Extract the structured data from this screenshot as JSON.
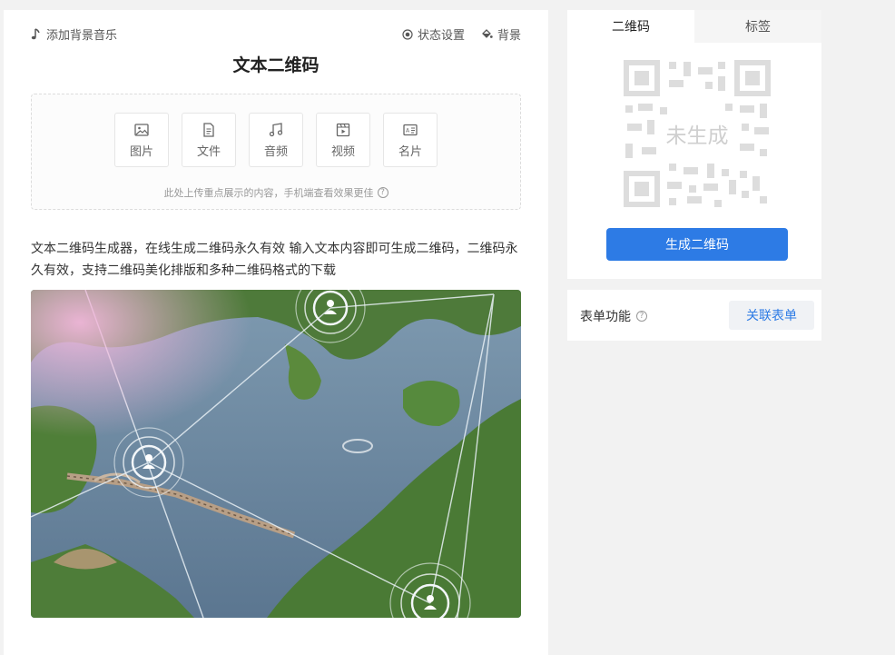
{
  "toolbar": {
    "music_label": "添加背景音乐",
    "status_label": "状态设置",
    "background_label": "背景"
  },
  "page_title": "文本二维码",
  "upload": {
    "tiles": [
      {
        "label": "图片",
        "icon": "image-icon"
      },
      {
        "label": "文件",
        "icon": "file-icon"
      },
      {
        "label": "音频",
        "icon": "audio-icon"
      },
      {
        "label": "视频",
        "icon": "video-icon"
      },
      {
        "label": "名片",
        "icon": "card-icon"
      }
    ],
    "hint": "此处上传重点展示的内容，手机端查看效果更佳"
  },
  "description": "文本二维码生成器，在线生成二维码永久有效 输入文本内容即可生成二维码，二维码永久有效，支持二维码美化排版和多种二维码格式的下载",
  "side_panel": {
    "tabs": [
      {
        "label": "二维码",
        "active": true
      },
      {
        "label": "标签",
        "active": false
      }
    ],
    "qr_placeholder": "未生成",
    "generate_button": "生成二维码"
  },
  "form_panel": {
    "label": "表单功能",
    "link_button": "关联表单"
  },
  "colors": {
    "accent": "#2d7be5",
    "background": "#f2f2f2"
  }
}
